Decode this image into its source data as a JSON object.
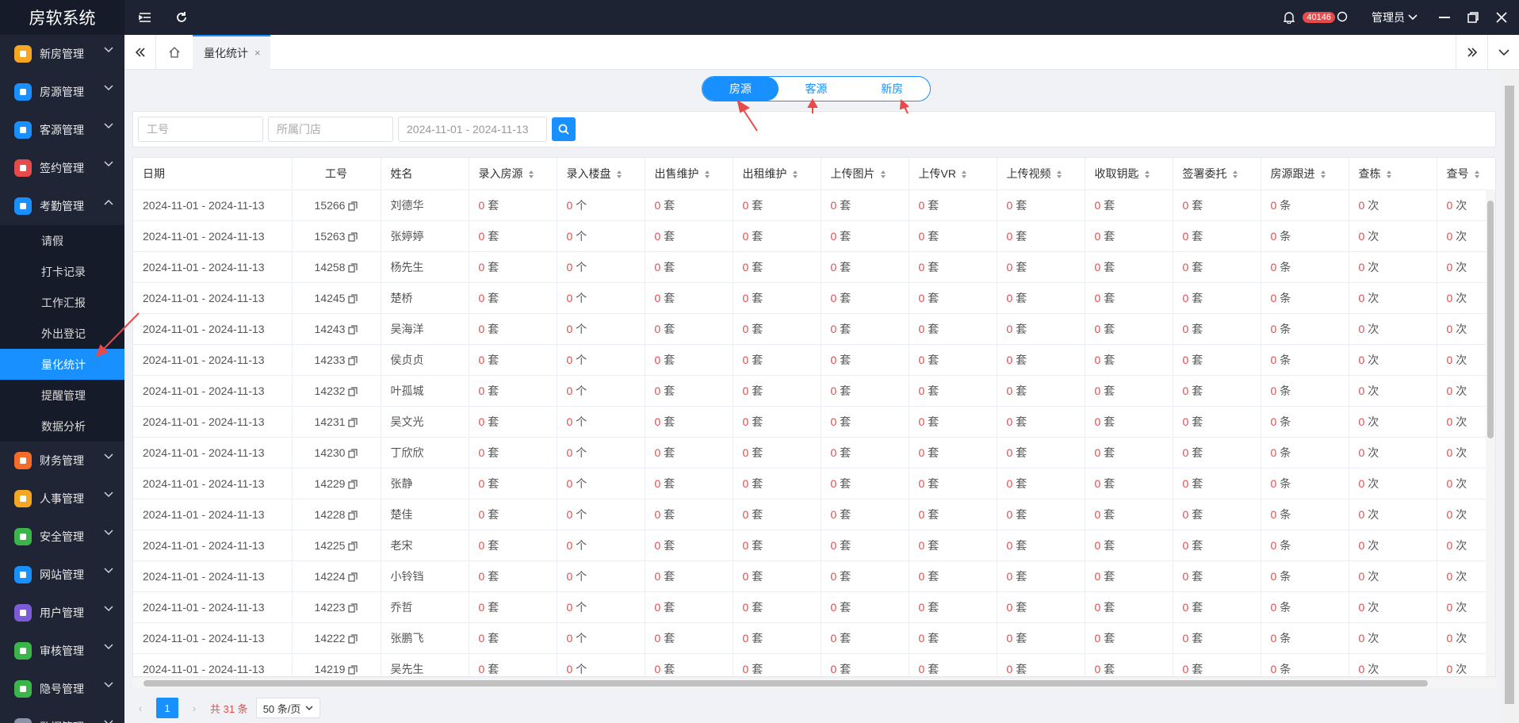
{
  "app": {
    "title": "房软系统"
  },
  "topbar": {
    "notification_count": "40146",
    "user": "管理员"
  },
  "sidebar": {
    "items": [
      {
        "label": "新房管理",
        "color": "#f5a623",
        "icon": "building-icon"
      },
      {
        "label": "房源管理",
        "color": "#1890ff",
        "icon": "home-icon"
      },
      {
        "label": "客源管理",
        "color": "#1890ff",
        "icon": "contacts-icon"
      },
      {
        "label": "签约管理",
        "color": "#e64b4b",
        "icon": "contract-icon"
      },
      {
        "label": "考勤管理",
        "color": "#1890ff",
        "icon": "location-icon"
      }
    ],
    "sub_items": [
      "请假",
      "打卡记录",
      "工作汇报",
      "外出登记",
      "量化统计",
      "提醒管理",
      "数据分析"
    ],
    "items_after": [
      {
        "label": "财务管理",
        "color": "#f56c2a",
        "icon": "finance-icon"
      },
      {
        "label": "人事管理",
        "color": "#f5a623",
        "icon": "people-icon"
      },
      {
        "label": "安全管理",
        "color": "#3bb54a",
        "icon": "shield-icon"
      },
      {
        "label": "网站管理",
        "color": "#1890ff",
        "icon": "web-icon"
      },
      {
        "label": "用户管理",
        "color": "#7b5cd6",
        "icon": "user-icon"
      },
      {
        "label": "审核管理",
        "color": "#3bb54a",
        "icon": "audit-icon"
      },
      {
        "label": "隐号管理",
        "color": "#3bb54a",
        "icon": "phone-icon"
      },
      {
        "label": "数据管理",
        "color": "#8a94a6",
        "icon": "data-icon"
      }
    ]
  },
  "tabs": {
    "active": "量化统计"
  },
  "segment": {
    "items": [
      "房源",
      "客源",
      "新房"
    ],
    "active": 0
  },
  "filter": {
    "job_no_placeholder": "工号",
    "store_placeholder": "所属门店",
    "date_range": "2024-11-01 - 2024-11-13"
  },
  "table": {
    "columns": [
      "日期",
      "工号",
      "姓名",
      "录入房源",
      "录入楼盘",
      "出售维护",
      "出租维护",
      "上传图片",
      "上传VR",
      "上传视频",
      "收取钥匙",
      "签署委托",
      "房源跟进",
      "查栋",
      "查号"
    ],
    "units": [
      "套",
      "个",
      "套",
      "套",
      "套",
      "套",
      "套",
      "套",
      "套",
      "条",
      "次",
      "次"
    ],
    "value": "0",
    "rows": [
      {
        "date": "2024-11-01 - 2024-11-13",
        "id": "15266",
        "name": "刘德华"
      },
      {
        "date": "2024-11-01 - 2024-11-13",
        "id": "15263",
        "name": "张婷婷"
      },
      {
        "date": "2024-11-01 - 2024-11-13",
        "id": "14258",
        "name": "杨先生"
      },
      {
        "date": "2024-11-01 - 2024-11-13",
        "id": "14245",
        "name": "楚桥"
      },
      {
        "date": "2024-11-01 - 2024-11-13",
        "id": "14243",
        "name": "吴海洋"
      },
      {
        "date": "2024-11-01 - 2024-11-13",
        "id": "14233",
        "name": "侯贞贞"
      },
      {
        "date": "2024-11-01 - 2024-11-13",
        "id": "14232",
        "name": "叶孤城"
      },
      {
        "date": "2024-11-01 - 2024-11-13",
        "id": "14231",
        "name": "吴文光"
      },
      {
        "date": "2024-11-01 - 2024-11-13",
        "id": "14230",
        "name": "丁欣欣"
      },
      {
        "date": "2024-11-01 - 2024-11-13",
        "id": "14229",
        "name": "张静"
      },
      {
        "date": "2024-11-01 - 2024-11-13",
        "id": "14228",
        "name": "楚佳"
      },
      {
        "date": "2024-11-01 - 2024-11-13",
        "id": "14225",
        "name": "老宋"
      },
      {
        "date": "2024-11-01 - 2024-11-13",
        "id": "14224",
        "name": "小铃铛"
      },
      {
        "date": "2024-11-01 - 2024-11-13",
        "id": "14223",
        "name": "乔哲"
      },
      {
        "date": "2024-11-01 - 2024-11-13",
        "id": "14222",
        "name": "张鹏飞"
      },
      {
        "date": "2024-11-01 - 2024-11-13",
        "id": "14219",
        "name": "吴先生"
      }
    ]
  },
  "pagination": {
    "current": "1",
    "total": "共 31 条",
    "page_size": "50 条/页"
  },
  "colors": {
    "accent": "#1890ff",
    "sidebar_bg": "#1f2535",
    "topbar_bg": "#1d2333",
    "alert_red": "#e64b4b"
  }
}
